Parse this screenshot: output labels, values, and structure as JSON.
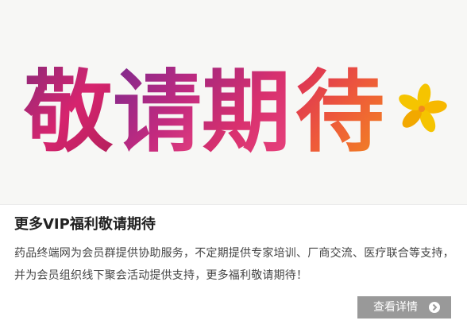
{
  "banner": {
    "headline": "敬请期待",
    "colors": {
      "background": "#f7f7f5",
      "magenta": "#d6246e",
      "purple": "#7a2a8f",
      "pink": "#e8447e",
      "orange": "#f28a1e",
      "yellow": "#f5c400"
    },
    "icon": "flower-icon"
  },
  "card": {
    "title": "更多VIP福利敬请期待",
    "description": "药品终端网为会员群提供协助服务，不定期提供专家培训、厂商交流、医疗联合等支持，并为会员组织线下聚会活动提供支持，更多福利敬请期待！",
    "more_button_label": "查看详情",
    "more_button_icon": "chevron-right-icon",
    "button_color": "#999999"
  }
}
